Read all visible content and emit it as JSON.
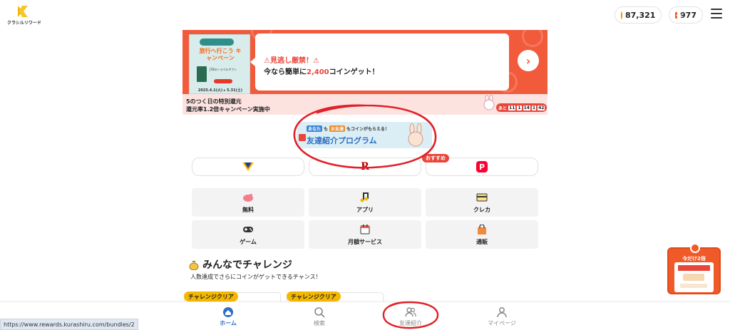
{
  "header": {
    "logo_text": "クラシルリワード",
    "coin_balance": "87,321",
    "mail_count": "977"
  },
  "banner": {
    "promo_top": "旅行へ行こう",
    "promo_title": "旅行へ行こう キャンペーン",
    "promo_text": "JTBのトラベルギフト",
    "promo_date": "2025.4.1(火) ▸ 5.31(土)",
    "alert_line": "⚠見逃し厳禁！⚠",
    "body_prefix": "今なら簡単に",
    "body_highlight": "2,400",
    "body_suffix": "コインゲット！",
    "arrow": "›",
    "bottom_line1": "5のつく日の特別還元",
    "bottom_line2": "還元率1.2倍キャンペーン実施中",
    "countdown_label": "あと",
    "countdown_values": [
      "11",
      "1",
      "14",
      "1",
      "42"
    ]
  },
  "referral": {
    "chip1": "あなた",
    "mid1": "も",
    "chip2": "お友達",
    "mid2": "もコインがもらえる！",
    "headline": "友達紹介プログラム"
  },
  "payments": {
    "badge": "おすすめ",
    "items": [
      "T",
      "R",
      "P"
    ]
  },
  "categories": [
    {
      "label": "無料",
      "icon": "piggy-bank-icon"
    },
    {
      "label": "アプリ",
      "icon": "music-note-icon"
    },
    {
      "label": "クレカ",
      "icon": "credit-card-icon"
    },
    {
      "label": "ゲーム",
      "icon": "gamepad-icon"
    },
    {
      "label": "月額サービス",
      "icon": "calendar-icon"
    },
    {
      "label": "通販",
      "icon": "shopping-bag-icon"
    }
  ],
  "challenge": {
    "title": "みんなでチャレンジ",
    "subtitle": "人数達成でさらにコインがゲットできるチャンス！",
    "badge1": "チャレンジクリア",
    "badge2": "チャレンジクリア"
  },
  "floating": {
    "label": "今だけ2倍"
  },
  "nav": {
    "items": [
      {
        "label": "ホーム",
        "icon": "home-coin-icon",
        "active": true
      },
      {
        "label": "検索",
        "icon": "search-icon",
        "active": false
      },
      {
        "label": "友達紹介",
        "icon": "friends-icon",
        "active": false
      },
      {
        "label": "マイページ",
        "icon": "user-icon",
        "active": false
      }
    ]
  },
  "status_url": "https://www.rewards.kurashiru.com/bundles/2",
  "colors": {
    "accent_red": "#f25a3c",
    "brand_blue": "#2f6fc2",
    "coin_gold": "#f5b800",
    "annotation_red": "#e0202a"
  }
}
